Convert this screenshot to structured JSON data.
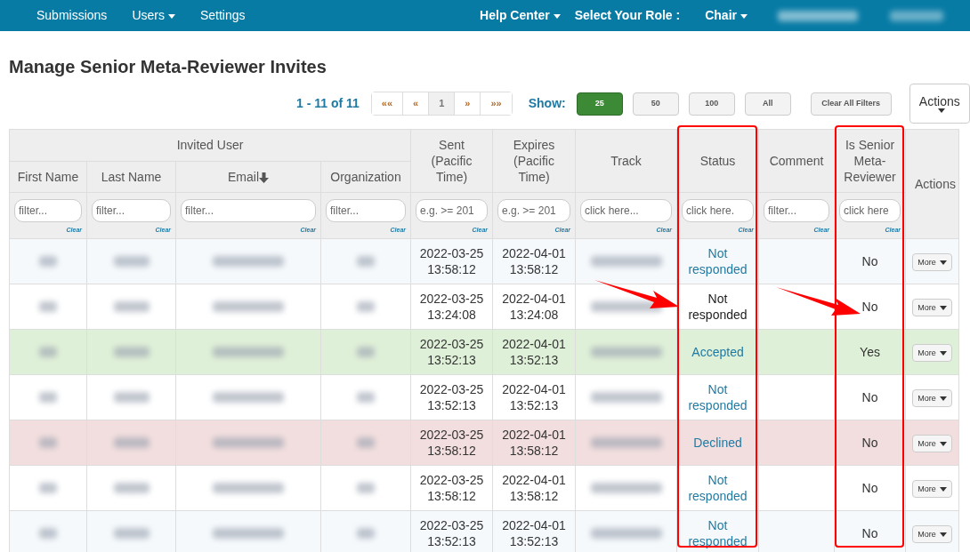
{
  "navbar": {
    "left": [
      {
        "label": "Submissions",
        "dropdown": false
      },
      {
        "label": "Users",
        "dropdown": true
      },
      {
        "label": "Settings",
        "dropdown": false
      }
    ],
    "right": [
      {
        "label": "Help Center",
        "dropdown": true
      },
      {
        "label": "Select Your Role :",
        "dropdown": false
      },
      {
        "label": "Chair",
        "dropdown": true
      }
    ]
  },
  "title": "Manage Senior Meta-Reviewer Invites",
  "pagination": {
    "summary": "1 - 11 of 11",
    "pages": [
      {
        "label": "««",
        "selected": false
      },
      {
        "label": "«",
        "selected": false
      },
      {
        "label": "1",
        "selected": true
      },
      {
        "label": "»",
        "selected": false
      },
      {
        "label": "»»",
        "selected": false
      }
    ]
  },
  "show": {
    "label": "Show:",
    "options": [
      {
        "label": "25",
        "selected": true
      },
      {
        "label": "50",
        "selected": false
      },
      {
        "label": "100",
        "selected": false
      },
      {
        "label": "All",
        "selected": false
      }
    ]
  },
  "clear_filters": "Clear All Filters",
  "actions_button": "Actions",
  "table": {
    "group_header": "Invited User",
    "columns": [
      {
        "label": "First Name",
        "group": true,
        "placeholder": "filter...",
        "clear": "Clear",
        "sorted": false,
        "highlighted": false
      },
      {
        "label": "Last Name",
        "group": true,
        "placeholder": "filter...",
        "clear": "Clear",
        "sorted": false,
        "highlighted": false
      },
      {
        "label": "Email",
        "group": true,
        "placeholder": "filter...",
        "clear": "Clear",
        "sorted": true,
        "highlighted": false
      },
      {
        "label": "Organization",
        "group": true,
        "placeholder": "filter...",
        "clear": "Clear",
        "sorted": false,
        "highlighted": false
      },
      {
        "label": "Sent (Pacific Time)",
        "group": false,
        "placeholder": "e.g. >= 201",
        "clear": "Clear",
        "sorted": false,
        "highlighted": false
      },
      {
        "label": "Expires (Pacific Time)",
        "group": false,
        "placeholder": "e.g. >= 201",
        "clear": "Clear",
        "sorted": false,
        "highlighted": false
      },
      {
        "label": "Track",
        "group": false,
        "placeholder": "click here...",
        "clear": "Clear",
        "sorted": false,
        "highlighted": false
      },
      {
        "label": "Status",
        "group": false,
        "placeholder": "click here.",
        "clear": "Clear",
        "sorted": false,
        "highlighted": true
      },
      {
        "label": "Comment",
        "group": false,
        "placeholder": "filter...",
        "clear": "Clear",
        "sorted": false,
        "highlighted": false
      },
      {
        "label": "Is Senior Meta-Reviewer",
        "group": false,
        "placeholder": "click here",
        "clear": "Clear",
        "sorted": false,
        "highlighted": true
      },
      {
        "label": "Actions",
        "group": false,
        "sorted": false,
        "highlighted": false
      }
    ],
    "rows": [
      {
        "color": "#f5f9fc",
        "sent": "2022-03-25 13:58:12",
        "expires": "2022-04-01 13:58:12",
        "status": "Not responded",
        "status_linked": true,
        "senior": "No",
        "action": "More",
        "arrow": false
      },
      {
        "color": "#ffffff",
        "sent": "2022-03-25 13:24:08",
        "expires": "2022-04-01 13:24:08",
        "status": "Not responded",
        "status_linked": false,
        "senior": "No",
        "action": "More",
        "arrow": true
      },
      {
        "color": "#dff0d8",
        "sent": "2022-03-25 13:52:13",
        "expires": "2022-04-01 13:52:13",
        "status": "Accepted",
        "status_linked": true,
        "senior": "Yes",
        "action": "More",
        "arrow": false
      },
      {
        "color": "#ffffff",
        "sent": "2022-03-25 13:52:13",
        "expires": "2022-04-01 13:52:13",
        "status": "Not responded",
        "status_linked": true,
        "senior": "No",
        "action": "More",
        "arrow": false
      },
      {
        "color": "#f2dede",
        "sent": "2022-03-25 13:58:12",
        "expires": "2022-04-01 13:58:12",
        "status": "Declined",
        "status_linked": true,
        "senior": "No",
        "action": "More",
        "arrow": false
      },
      {
        "color": "#ffffff",
        "sent": "2022-03-25 13:58:12",
        "expires": "2022-04-01 13:58:12",
        "status": "Not responded",
        "status_linked": true,
        "senior": "No",
        "action": "More",
        "arrow": false
      },
      {
        "color": "#f5f9fc",
        "sent": "2022-03-25 13:52:13",
        "expires": "2022-04-01 13:52:13",
        "status": "Not responded",
        "status_linked": true,
        "senior": "No",
        "action": "More",
        "arrow": false
      }
    ]
  }
}
